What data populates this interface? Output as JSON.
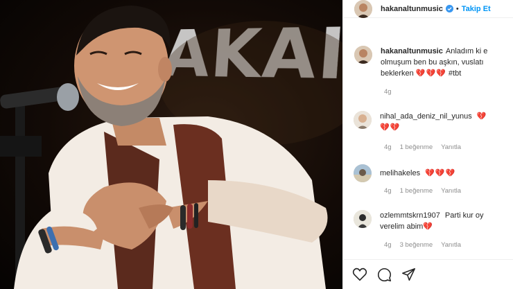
{
  "post": {
    "stage_text": "AKAI",
    "icon": "concert-photo"
  },
  "header": {
    "username": "hakanaltunmusic",
    "verified_icon": "verified-badge-icon",
    "separator": "•",
    "follow_label": "Takip Et"
  },
  "caption": {
    "username": "hakanaltunmusic",
    "line1": "Anladım ki e",
    "line2": "olmuşum ben bu aşkın, vuslatı",
    "line3_prefix": "beklerken",
    "hearts": "💔💔💔",
    "hashtag": "#tbt",
    "time": "4g"
  },
  "comments": [
    {
      "username": "nihal_ada_deniz_nil_yunus",
      "hearts_inline": "💔",
      "hearts_line2": "💔💔",
      "time": "4g",
      "likes": "1 beğenme",
      "reply": "Yanıtla"
    },
    {
      "username": "melihakeles",
      "hearts_inline": "💔💔💔",
      "time": "4g",
      "likes": "1 beğenme",
      "reply": "Yanıtla"
    },
    {
      "username": "ozlemmtskrn1907",
      "text_line1": "Parti kur oy",
      "text_line2": "verelim abim",
      "hearts_inline": "💔",
      "time": "4g",
      "likes": "3 beğenme",
      "reply": "Yanıtla"
    }
  ],
  "actions": {
    "like_icon": "heart-outline-icon",
    "comment_icon": "comment-icon",
    "share_icon": "send-icon"
  },
  "colors": {
    "link": "#0095f6",
    "text": "#262626",
    "muted": "#8e8e8e",
    "heart": "#b3123f"
  }
}
